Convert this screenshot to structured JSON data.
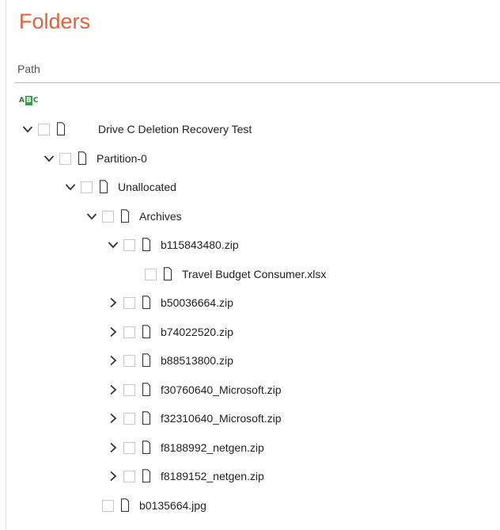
{
  "panel": {
    "title": "Folders",
    "column_header": "Path",
    "sort_icon": "abc-sort-icon",
    "sort_icon_letters": [
      "A",
      "B",
      "C"
    ]
  },
  "colors": {
    "title": "#e2603a",
    "sort_icon_green": "#2f9e44"
  },
  "tree": [
    {
      "label": "Drive C Deletion Recovery Test",
      "state": "expanded",
      "depth": 0
    },
    {
      "label": "Partition-0",
      "state": "expanded",
      "depth": 1
    },
    {
      "label": "Unallocated",
      "state": "expanded",
      "depth": 2
    },
    {
      "label": "Archives",
      "state": "expanded",
      "depth": 3
    },
    {
      "label": "b115843480.zip",
      "state": "expanded",
      "depth": 4
    },
    {
      "label": "Travel Budget Consumer.xlsx",
      "state": "leaf",
      "depth": 5
    },
    {
      "label": "b50036664.zip",
      "state": "collapsed",
      "depth": 4
    },
    {
      "label": "b74022520.zip",
      "state": "collapsed",
      "depth": 4
    },
    {
      "label": "b88513800.zip",
      "state": "collapsed",
      "depth": 4
    },
    {
      "label": "f30760640_Microsoft.zip",
      "state": "collapsed",
      "depth": 4
    },
    {
      "label": "f32310640_Microsoft.zip",
      "state": "collapsed",
      "depth": 4
    },
    {
      "label": "f8188992_netgen.zip",
      "state": "collapsed",
      "depth": 4
    },
    {
      "label": "f8189152_netgen.zip",
      "state": "collapsed",
      "depth": 4
    },
    {
      "label": "b0135664.jpg",
      "state": "leaf",
      "depth": 3
    }
  ]
}
